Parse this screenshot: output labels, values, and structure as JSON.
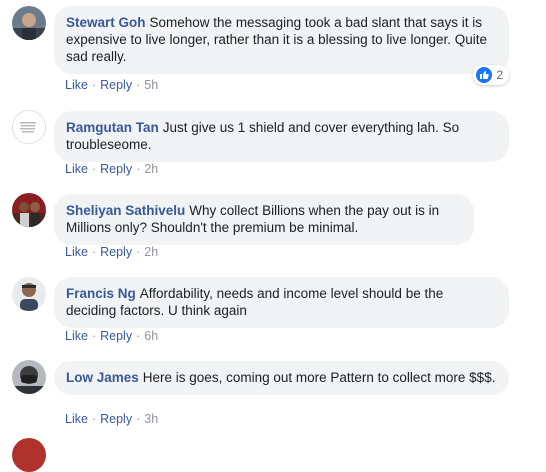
{
  "actions": {
    "like": "Like",
    "reply": "Reply",
    "separator": "·"
  },
  "comments": [
    {
      "author": "Stewart Goh",
      "text": "Somehow the messaging took a bad slant that says it is expensive to live longer, rather than it is a blessing to live longer. Quite sad really.",
      "time": "5h",
      "reaction_count": "2"
    },
    {
      "author": "Ramgutan Tan",
      "text": "Just give us 1 shield and cover everything lah. So troubleseome.",
      "time": "2h"
    },
    {
      "author": "Sheliyan Sathivelu",
      "text": "Why collect Billions when the pay out is in Millions only? Shouldn't the premium be minimal.",
      "time": "2h"
    },
    {
      "author": "Francis Ng",
      "text": "Affordability, needs and income level should be the deciding factors. U think again",
      "time": "6h"
    },
    {
      "author": "Low James",
      "text": "Here is goes, coming out more Pattern to collect more $$$.",
      "time": "3h"
    }
  ],
  "colors": {
    "author": "#385898",
    "bubble": "#f2f3f5",
    "like_badge": "#1877f2"
  }
}
